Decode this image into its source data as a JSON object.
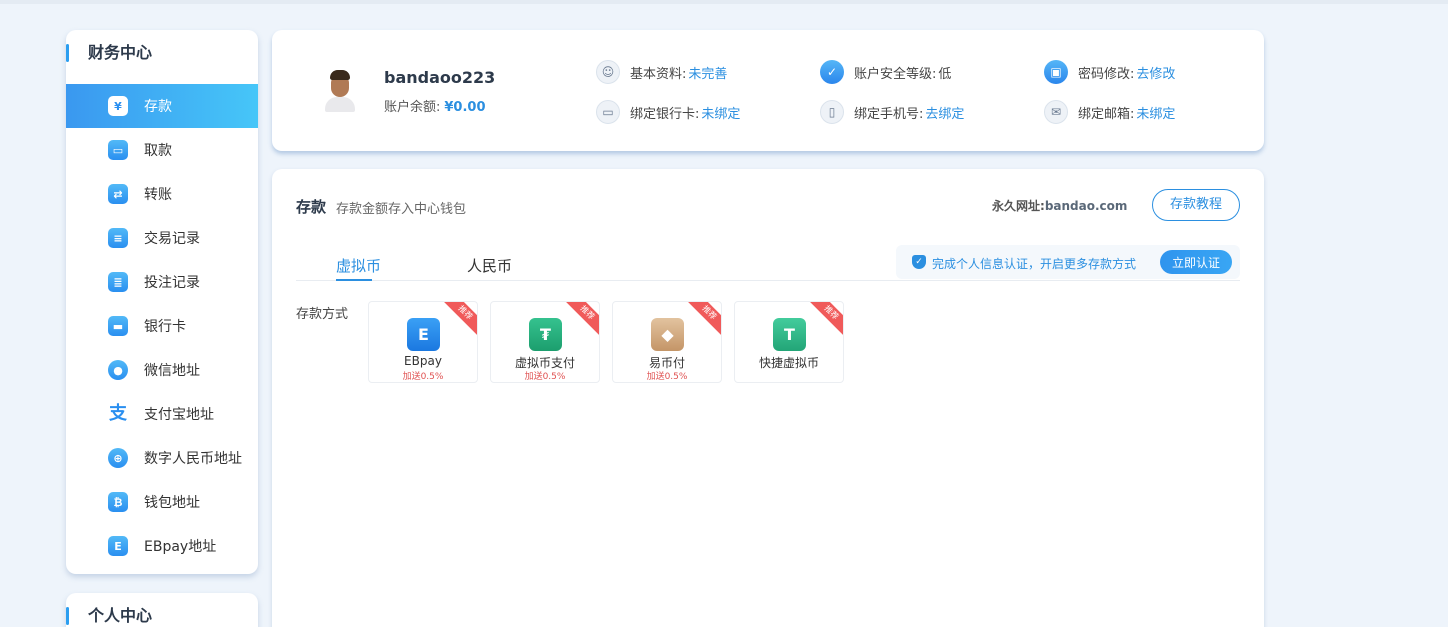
{
  "sidebar": {
    "title": "财务中心",
    "items": [
      {
        "label": "存款",
        "icon": "deposit-icon",
        "glyph": "¥"
      },
      {
        "label": "取款",
        "icon": "withdraw-icon",
        "glyph": "▭"
      },
      {
        "label": "转账",
        "icon": "transfer-icon",
        "glyph": "⇄"
      },
      {
        "label": "交易记录",
        "icon": "transaction-record-icon",
        "glyph": "≡"
      },
      {
        "label": "投注记录",
        "icon": "bet-record-icon",
        "glyph": "≣"
      },
      {
        "label": "银行卡",
        "icon": "bank-card-icon",
        "glyph": "▬"
      },
      {
        "label": "微信地址",
        "icon": "wechat-icon",
        "glyph": "●"
      },
      {
        "label": "支付宝地址",
        "icon": "alipay-icon",
        "glyph": "支"
      },
      {
        "label": "数字人民币地址",
        "icon": "digital-rmb-icon",
        "glyph": "⊕"
      },
      {
        "label": "钱包地址",
        "icon": "wallet-icon",
        "glyph": "₿"
      },
      {
        "label": "EBpay地址",
        "icon": "ebpay-icon",
        "glyph": "E"
      }
    ]
  },
  "sidebar2": {
    "title": "个人中心"
  },
  "profile": {
    "username": "bandaoo223",
    "balance_label": "账户余额:",
    "balance_value": "¥0.00",
    "info": {
      "basic": {
        "label": "基本资料:",
        "value": "未完善",
        "icon": "user-icon"
      },
      "security": {
        "label": "账户安全等级:",
        "value": "低",
        "icon": "shield-icon"
      },
      "password": {
        "label": "密码修改:",
        "value": "去修改",
        "icon": "lock-icon"
      },
      "bank": {
        "label": "绑定银行卡:",
        "value": "未绑定",
        "icon": "card-icon"
      },
      "phone": {
        "label": "绑定手机号:",
        "value": "去绑定",
        "icon": "phone-icon"
      },
      "email": {
        "label": "绑定邮箱:",
        "value": "未绑定",
        "icon": "mail-icon"
      }
    }
  },
  "main": {
    "title": "存款",
    "subtitle": "存款金额存入中心钱包",
    "perma_label": "永久网址:",
    "perma_url": "bandao.com",
    "tutorial_btn": "存款教程",
    "tabs": [
      "虚拟币",
      "人民币"
    ],
    "verify_text": "完成个人信息认证，开启更多存款方式",
    "verify_btn": "立即认证",
    "method_label": "存款方式",
    "methods": [
      {
        "name": "EBpay",
        "bonus": "加送0.5%",
        "badge": "推荐",
        "icon": "ebpay-icon",
        "glyph": "E"
      },
      {
        "name": "虚拟币支付",
        "bonus": "加送0.5%",
        "badge": "推荐",
        "icon": "usdt-icon",
        "glyph": "₮"
      },
      {
        "name": "易币付",
        "bonus": "加送0.5%",
        "badge": "推荐",
        "icon": "yibifu-icon",
        "glyph": "◆"
      },
      {
        "name": "快捷虚拟币",
        "bonus": "",
        "badge": "推荐",
        "icon": "quick-crypto-icon",
        "glyph": "T"
      }
    ]
  },
  "colors": {
    "accent": "#2b8fe0",
    "badge": "#f05a5a",
    "background": "#eef4fb"
  }
}
